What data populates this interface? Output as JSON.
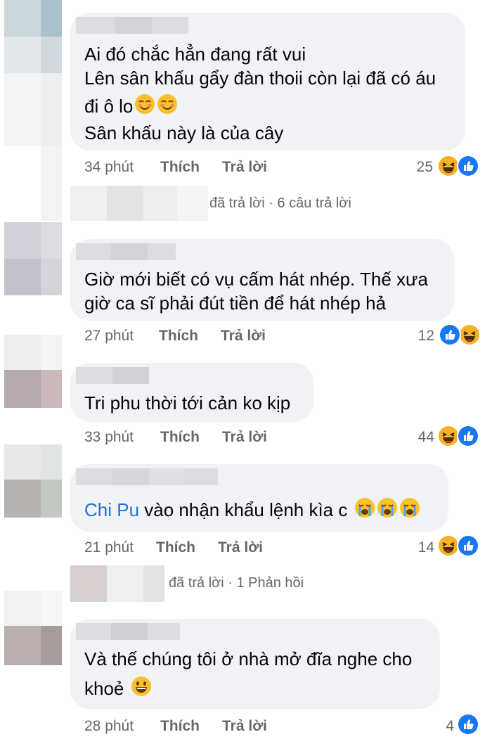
{
  "comments": [
    {
      "lines": [
        "Ai đó chắc hẳn đang rất vui",
        "Lên sân khấu gẩy đàn thoii còn lại đã có áu",
        "đi ô lo",
        "Sân khấu này là của cây"
      ],
      "time": "34 phút",
      "like": "Thích",
      "reply": "Trả lời",
      "count": "25",
      "reactions": [
        "haha-icon",
        "like-icon"
      ]
    },
    {
      "lines": [
        "Giờ mới biết có vụ cấm hát nhép. Thế xưa",
        "giờ ca sĩ phải đút tiền để hát nhép hả"
      ],
      "time": "27 phút",
      "like": "Thích",
      "reply": "Trả lời",
      "count": "12",
      "reactions": [
        "like-icon",
        "haha-icon"
      ]
    },
    {
      "lines": [
        "Tri phu thời tới cản ko kịp"
      ],
      "time": "33 phút",
      "like": "Thích",
      "reply": "Trả lời",
      "count": "44",
      "reactions": [
        "haha-icon",
        "like-icon"
      ]
    },
    {
      "mention": "Chi Pu",
      "lines": [
        " vào nhận khẩu lệnh kìa c"
      ],
      "time": "21 phút",
      "like": "Thích",
      "reply": "Trả lời",
      "count": "14",
      "reactions": [
        "haha-icon",
        "like-icon"
      ]
    },
    {
      "lines": [
        "Và thế chúng tôi ở nhà mở đĩa nghe cho",
        "khoẻ"
      ],
      "time": "28 phút",
      "like": "Thích",
      "reply": "Trả lời",
      "count": "4",
      "reactions": [
        "like-icon"
      ]
    }
  ],
  "replies": [
    {
      "text": "đã trả lời · 6 câu trả lời"
    },
    {
      "text": "đã trả lời · 1 Phản hồi"
    }
  ],
  "colors": {
    "bubble": "#f0f2f5",
    "meta": "#65676b",
    "mention": "#216fdb",
    "like_blue": "#1877f2",
    "haha_yellow": "#f7b125"
  }
}
